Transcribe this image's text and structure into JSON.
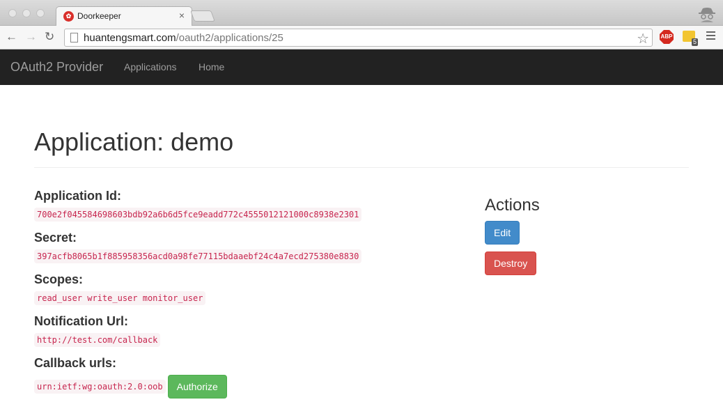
{
  "browser": {
    "tab_title": "Doorkeeper",
    "url_host": "huantengsmart.com",
    "url_path": "/oauth2/applications/25",
    "extension_badge": "5",
    "abp_label": "ABP"
  },
  "navbar": {
    "brand": "OAuth2 Provider",
    "links": [
      "Applications",
      "Home"
    ]
  },
  "page": {
    "title": "Application: demo",
    "fields": {
      "app_id_label": "Application Id:",
      "app_id_value": "700e2f045584698603bdb92a6b6d5fce9eadd772c4555012121000c8938e2301",
      "secret_label": "Secret:",
      "secret_value": "397acfb8065b1f885958356acd0a98fe77115bdaaebf24c4a7ecd275380e8830",
      "scopes_label": "Scopes:",
      "scopes_value": "read_user write_user monitor_user",
      "notification_label": "Notification Url:",
      "notification_value": "http://test.com/callback",
      "callback_label": "Callback urls:",
      "callback_value": "urn:ietf:wg:oauth:2.0:oob",
      "authorize_label": "Authorize"
    },
    "actions": {
      "heading": "Actions",
      "edit_label": "Edit",
      "destroy_label": "Destroy"
    }
  }
}
